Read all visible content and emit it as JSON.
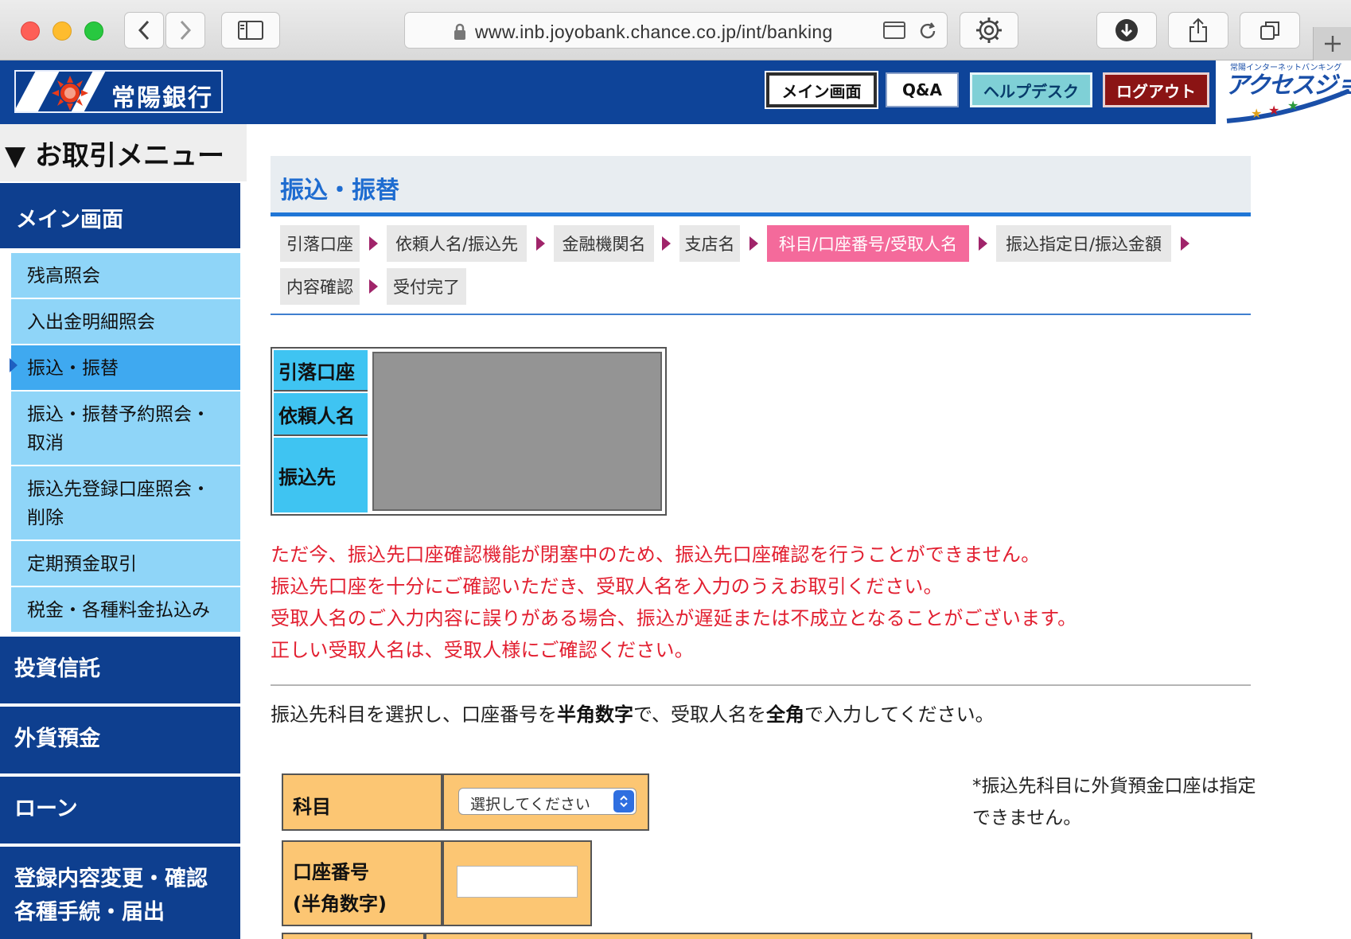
{
  "browser": {
    "url": "www.inb.joyobank.chance.co.jp/int/banking"
  },
  "header": {
    "bank_name": "常陽銀行",
    "buttons": {
      "main": "メイン画面",
      "qa": "Q&A",
      "help": "ヘルプデスク",
      "logout": "ログアウト"
    },
    "access_logo_text": "アクセスジョイ",
    "access_logo_tagline": "常陽インターネットバンキング"
  },
  "sidebar": {
    "title": "▼ お取引メニュー",
    "main_label": "メイン画面",
    "sub_items": [
      {
        "label": "残高照会",
        "active": false
      },
      {
        "label": "入出金明細照会",
        "active": false
      },
      {
        "label": "振込・振替",
        "active": true
      },
      {
        "label": "振込・振替予約照会・取消",
        "active": false
      },
      {
        "label": "振込先登録口座照会・削除",
        "active": false
      },
      {
        "label": "定期預金取引",
        "active": false
      },
      {
        "label": "税金・各種料金払込み",
        "active": false
      }
    ],
    "sections": [
      {
        "label": "投資信託"
      },
      {
        "label": "外貨預金"
      },
      {
        "label": "ローン"
      },
      {
        "label": "登録内容変更・確認\n各種手続・届出"
      }
    ]
  },
  "page": {
    "title": "振込・振替",
    "steps": [
      {
        "label": "引落口座",
        "current": false
      },
      {
        "label": "依頼人名/振込先",
        "current": false
      },
      {
        "label": "金融機関名",
        "current": false
      },
      {
        "label": "支店名",
        "current": false
      },
      {
        "label": "科目/口座番号/受取人名",
        "current": true
      },
      {
        "label": "振込指定日/振込金額",
        "current": false
      },
      {
        "label": "内容確認",
        "current": false
      },
      {
        "label": "受付完了",
        "current": false
      }
    ],
    "info_table": {
      "rows": [
        "引落口座",
        "依頼人名",
        "振込先"
      ]
    },
    "warnings": [
      "ただ今、振込先口座確認機能が閉塞中のため、振込先口座確認を行うことができません。",
      "振込先口座を十分にご確認いただき、受取人名を入力のうえお取引ください。",
      "受取人名のご入力内容に誤りがある場合、振込が遅延または不成立となることがございます。",
      "正しい受取人名は、受取人様にご確認ください。"
    ],
    "instruction": {
      "part1": "振込先科目を選択し、口座番号を",
      "bold1": "半角数字",
      "part2": "で、受取人名を",
      "bold2": "全角",
      "part3": "で入力してください。"
    },
    "form": {
      "subject_label": "科目",
      "subject_placeholder": "選択してください",
      "account_label_line1": "口座番号",
      "account_label_line2": "(半角数字)",
      "account_value": ""
    },
    "note": "*振込先科目に外貨預金口座は指定できません。"
  },
  "colors": {
    "header_bg": "#0e4499",
    "sidebar_dark": "#0e3f8f",
    "sidebar_light": "#8fd5f8",
    "sidebar_active": "#3fa9f0",
    "step_current": "#f46a9b",
    "warning_text": "#e21f30",
    "form_cell": "#fcc673",
    "info_header": "#3fc4f2"
  }
}
